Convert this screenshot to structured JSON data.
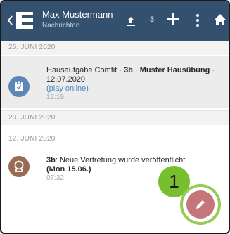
{
  "header": {
    "title": "Max Mustermann",
    "subtitle": "Nachrichten",
    "upload_count": "3",
    "icons": [
      "back-chevron-icon",
      "e-logo",
      "upload-icon",
      "plus-icon",
      "more-vert-icon",
      "home-icon"
    ]
  },
  "sections": [
    {
      "date": "25. JUNI 2020",
      "messages": [
        {
          "parts": [
            "Hausaufgabe Comfit · ",
            "3b",
            " · ",
            "Muster Hausübung",
            " · 12.07.2020"
          ],
          "link": "(play online)",
          "time": "12:19",
          "avatar_icon": "clipboard-icon"
        }
      ]
    },
    {
      "date": "23. JUNI 2020",
      "messages": []
    },
    {
      "date": "12. JUNI 2020",
      "messages": [
        {
          "parts": [
            "3b",
            ": Neue Vertretung wurde veröffentlicht",
            "(Mon 15.06.)"
          ],
          "time": "07:32",
          "avatar_icon": "substitute-icon"
        }
      ]
    }
  ],
  "annotation": {
    "number": "1"
  },
  "colors": {
    "header": "#34506f",
    "fab": "#c4767a",
    "annotation": "#78bf2f",
    "link": "#4a8ac4"
  }
}
